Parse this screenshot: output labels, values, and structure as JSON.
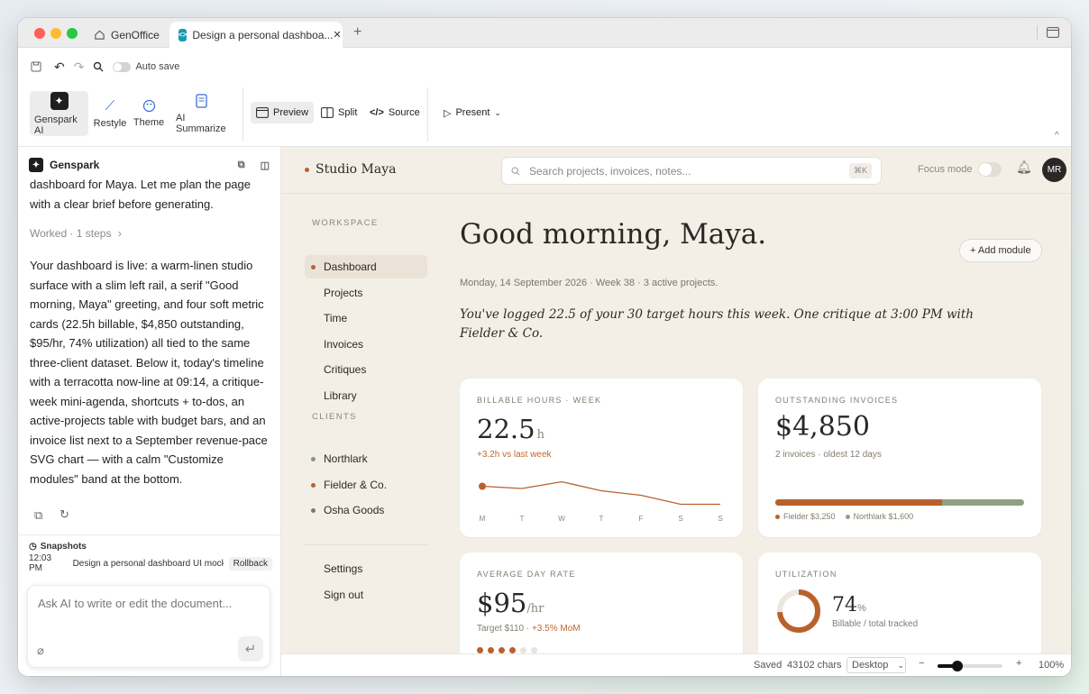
{
  "tabs": {
    "home": "GenOffice",
    "doc": "Design a personal dashboa..."
  },
  "toolbar": {
    "autosave": "Auto save"
  },
  "ribbon": {
    "ai": "Genspark AI",
    "restyle": "Restyle",
    "theme": "Theme",
    "summarize": "AI Summarize",
    "preview": "Preview",
    "split": "Split",
    "source": "Source",
    "present": "Present"
  },
  "panel": {
    "title": "Genspark",
    "intro": "dashboard for Maya. Let me plan the page with a clear brief before generating.",
    "worked": "Worked · 1 steps",
    "reply": "Your dashboard is live: a warm-linen studio surface with a slim left rail, a serif \"Good morning, Maya\" greeting, and four soft metric cards (22.5h billable, $4,850 outstanding, $95/hr, 74% utilization) all tied to the same three-client dataset. Below it, today's timeline with a terracotta now-line at 09:14, a critique-week mini-agenda, shortcuts + to-dos, an active-projects table with budget bars, and an invoice list next to a September revenue-pace SVG chart — with a calm \"Customize modules\" band at the bottom.",
    "snapshots": "Snapshots",
    "snap_time": "12:03 PM",
    "snap_title": "Design a personal dashboard UI mock",
    "rollback": "Rollback",
    "placeholder": "Ask AI to write or edit the document..."
  },
  "dashboard": {
    "brand": "Studio Maya",
    "search_placeholder": "Search projects, invoices, notes...",
    "search_shortcut": "⌘K",
    "focus_mode": "Focus mode",
    "avatar": "MR",
    "nav": {
      "workspace_title": "WORKSPACE",
      "workspace": [
        "Dashboard",
        "Projects",
        "Time",
        "Invoices",
        "Critiques",
        "Library"
      ],
      "clients_title": "CLIENTS",
      "clients": [
        "Northlark",
        "Fielder & Co.",
        "Osha Goods"
      ],
      "footer": [
        "Settings",
        "Sign out"
      ]
    },
    "greeting": "Good morning, Maya.",
    "date_line": "Monday, 14 September 2026 · Week 38 · 3 active projects.",
    "summary": "You've logged 22.5 of your 30 target hours this week. One critique at 3:00 PM with Fielder & Co.",
    "add_module": "+ Add module",
    "cards": {
      "billable": {
        "label": "BILLABLE HOURS · WEEK",
        "value": "22.5",
        "unit": "h",
        "delta": "+3.2h vs last week",
        "days": [
          "M",
          "T",
          "W",
          "T",
          "F",
          "S",
          "S"
        ]
      },
      "invoices": {
        "label": "OUTSTANDING INVOICES",
        "value": "$4,850",
        "sub": "2 invoices · oldest 12 days",
        "legend1": "Fielder $3,250",
        "legend2": "Northlark $1,600"
      },
      "rate": {
        "label": "AVERAGE DAY RATE",
        "value": "$95",
        "unit": "/hr",
        "sub_a": "Target $110 · ",
        "sub_b": "+3.5% MoM"
      },
      "util": {
        "label": "UTILIZATION",
        "value": "74",
        "unit": "%",
        "sub": "Billable / total tracked"
      }
    }
  },
  "statusbar": {
    "saved": "Saved",
    "chars": "43102 chars",
    "device": "Desktop",
    "zoom": "100%"
  },
  "data": {
    "hours_by_day": [
      9,
      8,
      11,
      7,
      5,
      1,
      1
    ],
    "invoice_split": [
      3250,
      1600
    ],
    "rate_level": 4,
    "rate_level_max": 6,
    "utilization": 0.74,
    "zoom_level": 0.3
  },
  "colors": {
    "accent": "#b9612e",
    "green": "#8ea183",
    "canvas": "#f3efe7",
    "gray": "#7a7a7a"
  }
}
